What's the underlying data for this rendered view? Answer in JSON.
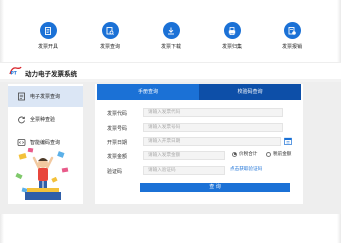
{
  "toolbar": {
    "items": [
      {
        "label": "发票开具",
        "icon": "invoice-issue-icon"
      },
      {
        "label": "发票查询",
        "icon": "invoice-search-icon"
      },
      {
        "label": "发票下载",
        "icon": "download-icon"
      },
      {
        "label": "发票归集",
        "icon": "printer-icon"
      },
      {
        "label": "发票报销",
        "icon": "reimburse-icon"
      }
    ]
  },
  "brand": {
    "title": "动力电子发票系统"
  },
  "sidebar": {
    "items": [
      {
        "label": "电子发票查询",
        "icon": "document-icon",
        "active": true
      },
      {
        "label": "全票种查验",
        "icon": "refresh-check-icon",
        "active": false
      },
      {
        "label": "智能编码查询",
        "icon": "code-icon",
        "active": false
      }
    ]
  },
  "tabs": [
    {
      "label": "手册查询",
      "active": true
    },
    {
      "label": "校验码查询",
      "active": false
    }
  ],
  "form": {
    "invoice_code": {
      "label": "发票代码",
      "placeholder": "请输入发票代码"
    },
    "invoice_number": {
      "label": "发票号码",
      "placeholder": "请输入发票号码"
    },
    "issue_date": {
      "label": "开票日期",
      "placeholder": "请输入开票日期"
    },
    "amount": {
      "label": "发票金额",
      "placeholder": "请输入发票金额"
    },
    "price_options": [
      {
        "label": "价税合计",
        "checked": true
      },
      {
        "label": "税前金额",
        "checked": false
      }
    ],
    "captcha": {
      "label": "验证码",
      "placeholder": "请输入验证码",
      "link": "点击获取验证码"
    },
    "submit_label": "查 询"
  },
  "colors": {
    "accent": "#1b71d6",
    "tab_inactive": "#0d4fa8",
    "sidebar_active": "#dbe6f5"
  }
}
